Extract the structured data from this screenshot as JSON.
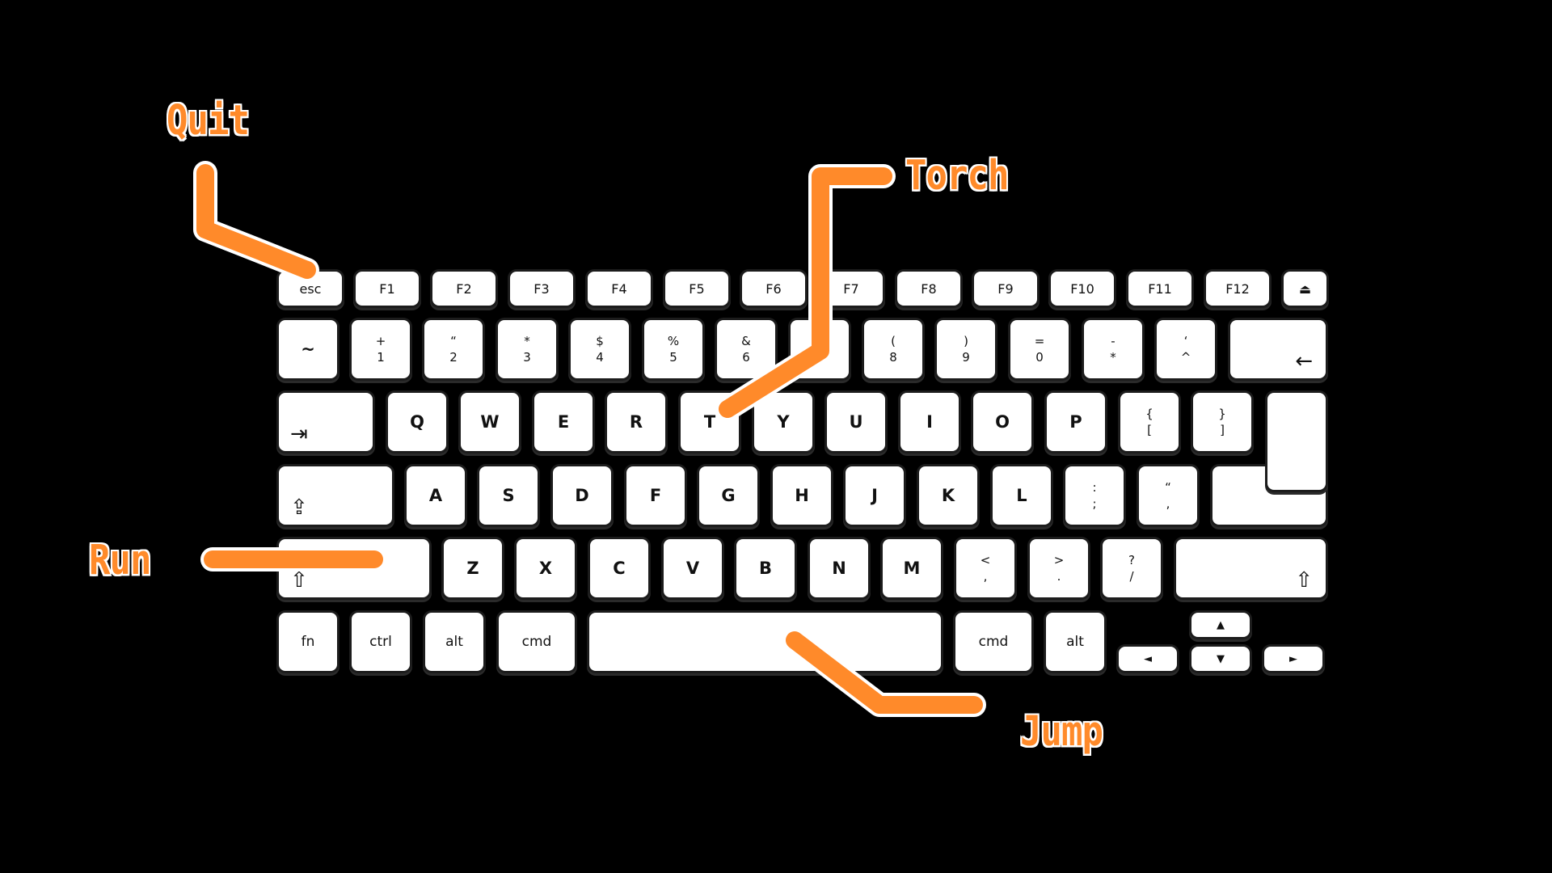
{
  "rows": [
    [
      {
        "main": "esc",
        "cls": "fn"
      },
      {
        "main": "F1",
        "cls": "fn"
      },
      {
        "main": "F2",
        "cls": "fn"
      },
      {
        "main": "F3",
        "cls": "fn"
      },
      {
        "main": "F4",
        "cls": "fn"
      },
      {
        "main": "F5",
        "cls": "fn"
      },
      {
        "main": "F6",
        "cls": "fn"
      },
      {
        "main": "F7",
        "cls": "fn"
      },
      {
        "main": "F8",
        "cls": "fn"
      },
      {
        "main": "F9",
        "cls": "fn"
      },
      {
        "main": "F10",
        "cls": "fn"
      },
      {
        "main": "F11",
        "cls": "fn"
      },
      {
        "main": "F12",
        "cls": "fn"
      },
      {
        "main": "⏏",
        "cls": "fn",
        "name": "eject"
      }
    ],
    [
      {
        "main": "~"
      },
      {
        "top": "+",
        "bot": "1"
      },
      {
        "top": "“",
        "bot": "2"
      },
      {
        "top": "*",
        "bot": "3"
      },
      {
        "top": "$",
        "bot": "4"
      },
      {
        "top": "%",
        "bot": "5"
      },
      {
        "top": "&",
        "bot": "6"
      },
      {
        "top": "",
        "bot": ""
      },
      {
        "top": "(",
        "bot": "8"
      },
      {
        "top": ")",
        "bot": "9"
      },
      {
        "top": "=",
        "bot": "0"
      },
      {
        "top": "-",
        "bot": "*"
      },
      {
        "top": "‘",
        "bot": "^"
      },
      {
        "icon": "←",
        "name": "backspace"
      }
    ],
    [
      {
        "icon": "⇥",
        "name": "tab"
      },
      {
        "main": "Q"
      },
      {
        "main": "W"
      },
      {
        "main": "E"
      },
      {
        "main": "R"
      },
      {
        "main": "T"
      },
      {
        "main": "Y"
      },
      {
        "main": "U"
      },
      {
        "main": "I"
      },
      {
        "main": "O"
      },
      {
        "main": "P"
      },
      {
        "top": "{",
        "bot": "["
      },
      {
        "top": "}",
        "bot": "]"
      }
    ],
    [
      {
        "icon": "⇪",
        "name": "caps-lock"
      },
      {
        "main": "A"
      },
      {
        "main": "S"
      },
      {
        "main": "D"
      },
      {
        "main": "F"
      },
      {
        "main": "G"
      },
      {
        "main": "H"
      },
      {
        "main": "J"
      },
      {
        "main": "K"
      },
      {
        "main": "L"
      },
      {
        "top": ":",
        "bot": ";"
      },
      {
        "top": "“",
        "bot": ","
      },
      {
        "icon": "↵",
        "name": "enter"
      }
    ],
    [
      {
        "icon": "⇧",
        "name": "left-shift"
      },
      {
        "main": "Z"
      },
      {
        "main": "X"
      },
      {
        "main": "C"
      },
      {
        "main": "V"
      },
      {
        "main": "B"
      },
      {
        "main": "N"
      },
      {
        "main": "M"
      },
      {
        "top": "<",
        "bot": ","
      },
      {
        "top": ">",
        "bot": "."
      },
      {
        "top": "?",
        "bot": "/"
      },
      {
        "icon": "⇧",
        "name": "right-shift"
      }
    ],
    [
      {
        "main": "fn",
        "cls": "mod"
      },
      {
        "main": "ctrl",
        "cls": "mod"
      },
      {
        "main": "alt",
        "cls": "mod"
      },
      {
        "main": "cmd",
        "cls": "mod"
      },
      {
        "main": "",
        "name": "space"
      },
      {
        "main": "cmd",
        "cls": "mod"
      },
      {
        "main": "alt",
        "cls": "mod"
      },
      {
        "main": "▲",
        "cls": "arrow",
        "name": "arrow-up"
      },
      {
        "main": "◄",
        "cls": "arrow",
        "name": "arrow-left"
      },
      {
        "main": "▼",
        "cls": "arrow",
        "name": "arrow-down"
      },
      {
        "main": "►",
        "cls": "arrow",
        "name": "arrow-right"
      }
    ]
  ],
  "labels": {
    "quit": "Quit",
    "torch": "Torch",
    "run": "Run",
    "jump": "Jump"
  },
  "colors": {
    "accent": "#ff8a2a",
    "background": "#000000",
    "key": "#ffffff"
  }
}
